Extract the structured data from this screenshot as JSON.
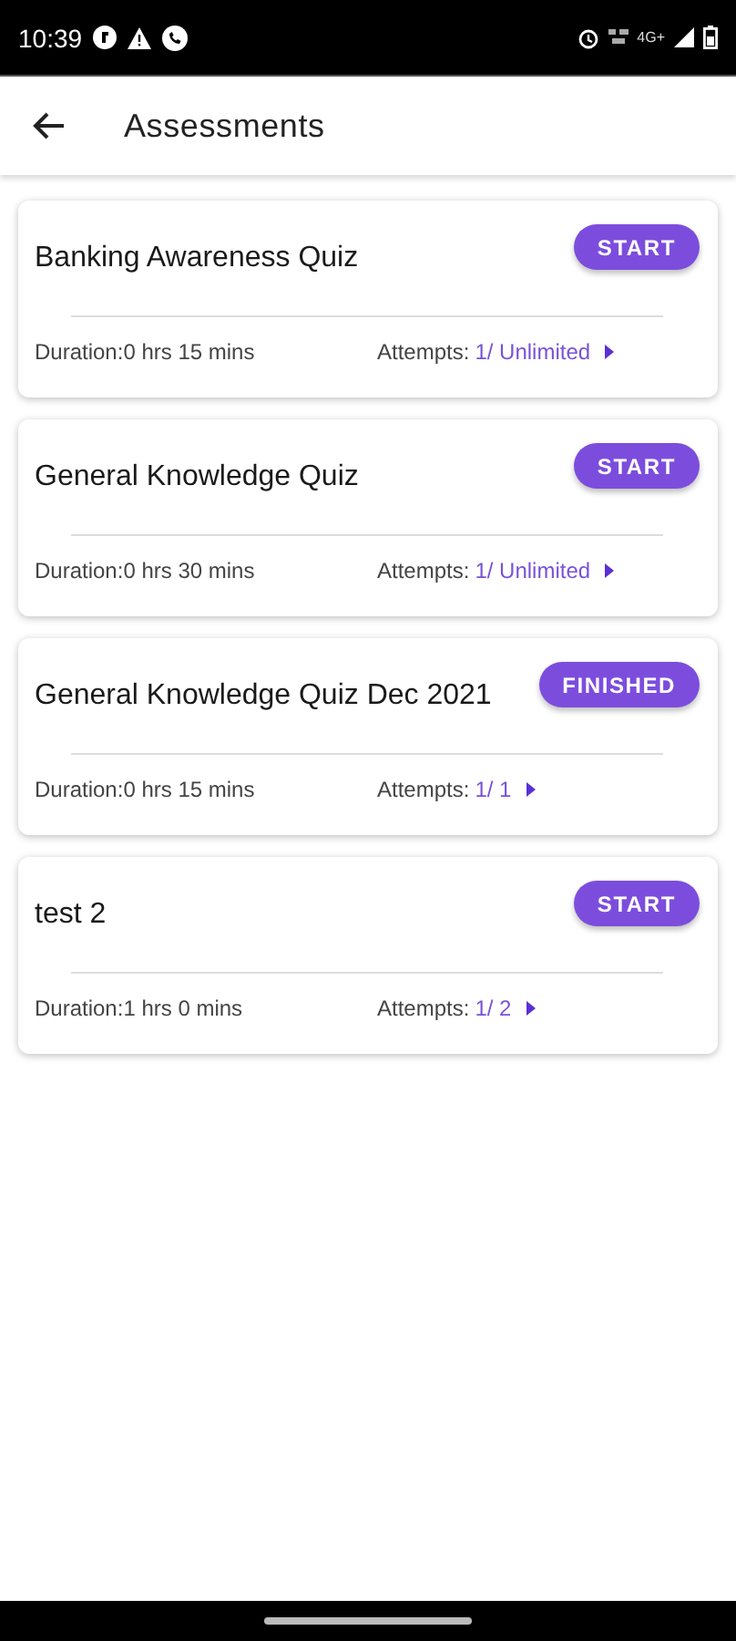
{
  "status_bar": {
    "time": "10:39",
    "network": "4G+"
  },
  "app_bar": {
    "title": "Assessments"
  },
  "assessments": [
    {
      "title": "Banking Awareness Quiz",
      "action": "START",
      "duration": "Duration:0 hrs 15 mins",
      "attempts_label": "Attempts:",
      "attempts_value": "1/ Unlimited"
    },
    {
      "title": "General Knowledge Quiz",
      "action": "START",
      "duration": "Duration:0 hrs 30 mins",
      "attempts_label": "Attempts:",
      "attempts_value": "1/ Unlimited"
    },
    {
      "title": "General Knowledge Quiz Dec 2021",
      "action": "FINISHED",
      "duration": "Duration:0 hrs 15 mins",
      "attempts_label": "Attempts:",
      "attempts_value": "1/ 1"
    },
    {
      "title": "test 2",
      "action": "START",
      "duration": "Duration:1 hrs 0 mins",
      "attempts_label": "Attempts:",
      "attempts_value": "1/ 2"
    }
  ]
}
